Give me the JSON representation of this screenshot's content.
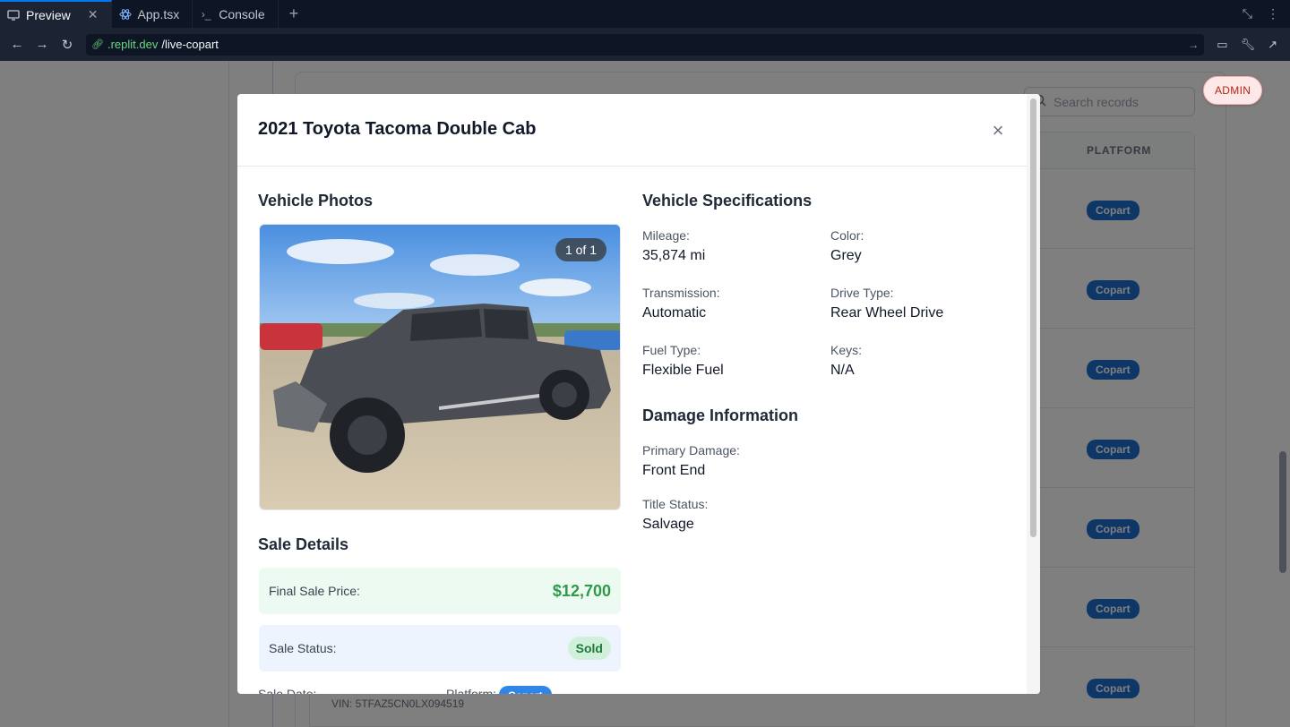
{
  "chrome": {
    "tabs": [
      {
        "label": "Preview",
        "icon": "monitor-icon"
      },
      {
        "label": "App.tsx",
        "icon": "react-icon"
      },
      {
        "label": "Console",
        "icon": "terminal-icon"
      }
    ],
    "url": {
      "host": ".replit.dev",
      "path": "/live-copart"
    }
  },
  "background": {
    "search_placeholder": "Search records",
    "platform_header": "PLATFORM",
    "platform_badge": "Copart",
    "admin_label": "ADMIN",
    "vin_text": "VIN: 5TFAZ5CN0LX094519"
  },
  "modal": {
    "title": "2021 Toyota Tacoma Double Cab",
    "photos": {
      "title": "Vehicle Photos",
      "counter": "1 of 1"
    },
    "specs": {
      "title": "Vehicle Specifications",
      "mileage": {
        "label": "Mileage:",
        "value": "35,874 mi"
      },
      "color": {
        "label": "Color:",
        "value": "Grey"
      },
      "transmission": {
        "label": "Transmission:",
        "value": "Automatic"
      },
      "drive_type": {
        "label": "Drive Type:",
        "value": "Rear Wheel Drive"
      },
      "fuel_type": {
        "label": "Fuel Type:",
        "value": "Flexible Fuel"
      },
      "keys": {
        "label": "Keys:",
        "value": "N/A"
      }
    },
    "damage": {
      "title": "Damage Information",
      "primary": {
        "label": "Primary Damage:",
        "value": "Front End"
      },
      "title_status": {
        "label": "Title Status:",
        "value": "Salvage"
      }
    },
    "sale": {
      "title": "Sale Details",
      "final_price": {
        "label": "Final Sale Price:",
        "value": "$12,700"
      },
      "status": {
        "label": "Sale Status:",
        "value": "Sold"
      },
      "sale_date_label": "Sale Date:",
      "platform_label": "Platform:",
      "platform_value": "Copart"
    }
  },
  "colors": {
    "accent": "#0079f2",
    "price_green": "#2e9b4a",
    "badge_blue": "#1d6fd1"
  }
}
